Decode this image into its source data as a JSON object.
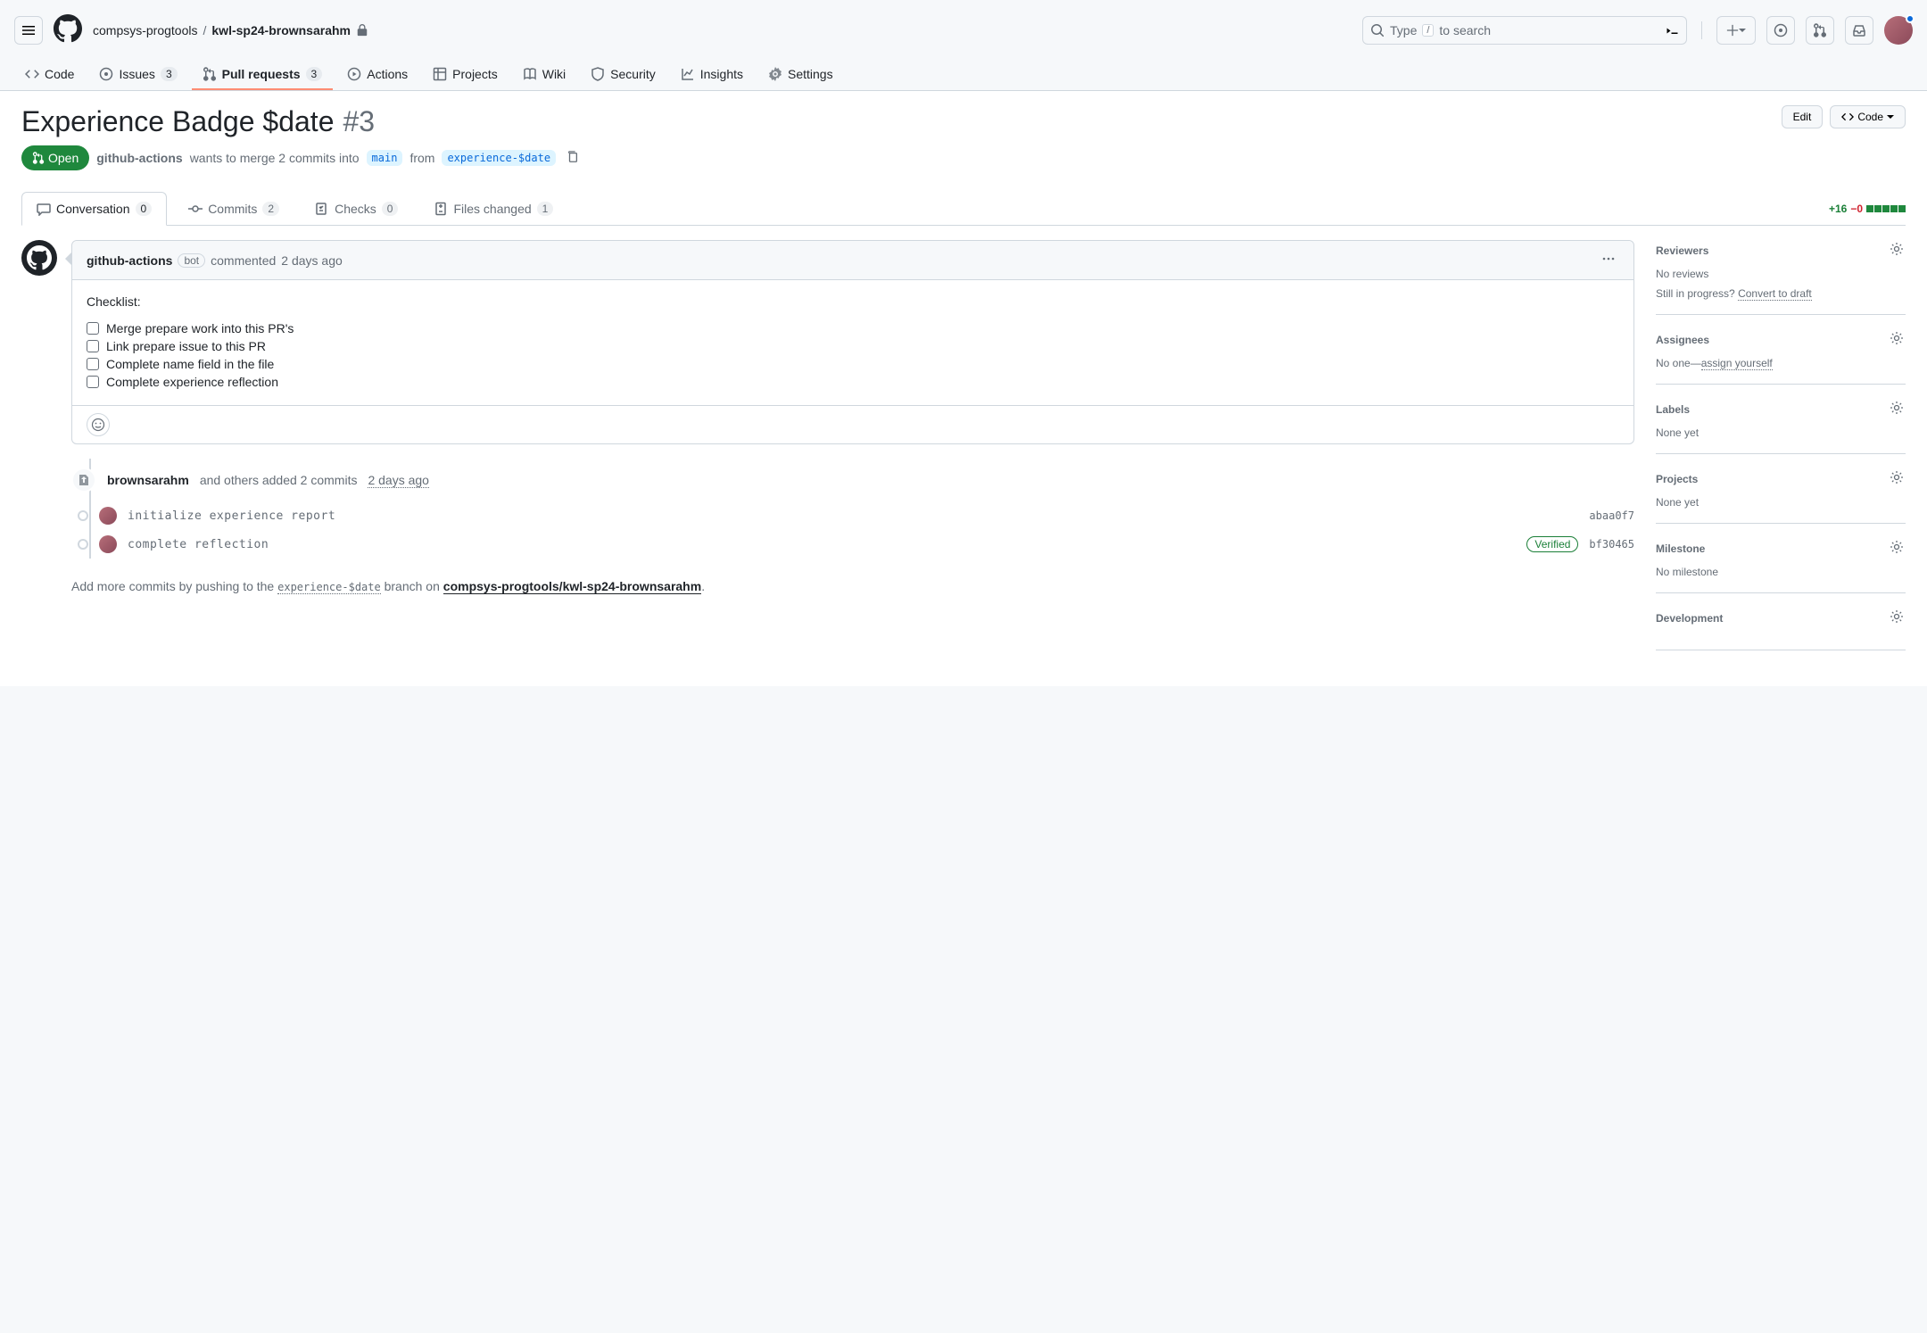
{
  "header": {
    "breadcrumb": {
      "owner": "compsys-progtools",
      "repo": "kwl-sp24-brownsarahm"
    },
    "search": {
      "placeholder_prefix": "Type",
      "placeholder_key": "/",
      "placeholder_suffix": "to search"
    }
  },
  "nav": {
    "code": "Code",
    "issues": {
      "label": "Issues",
      "count": "3"
    },
    "pull_requests": {
      "label": "Pull requests",
      "count": "3"
    },
    "actions": "Actions",
    "projects": "Projects",
    "wiki": "Wiki",
    "security": "Security",
    "insights": "Insights",
    "settings": "Settings"
  },
  "pr": {
    "title": "Experience Badge $date",
    "number": "#3",
    "edit": "Edit",
    "code_btn": "Code",
    "state": "Open",
    "author": "github-actions",
    "merge_text_1": "wants to merge 2 commits into",
    "base": "main",
    "merge_text_2": "from",
    "head": "experience-$date"
  },
  "tabs": {
    "conversation": {
      "label": "Conversation",
      "count": "0"
    },
    "commits": {
      "label": "Commits",
      "count": "2"
    },
    "checks": {
      "label": "Checks",
      "count": "0"
    },
    "files": {
      "label": "Files changed",
      "count": "1"
    },
    "additions": "+16",
    "deletions": "−0"
  },
  "comment": {
    "author": "github-actions",
    "bot": "bot",
    "commented": "commented",
    "time": "2 days ago",
    "body_intro": "Checklist:",
    "tasks": [
      "Merge prepare work into this PR's",
      "Link prepare issue to this PR",
      "Complete name field in the file",
      "Complete experience reflection"
    ]
  },
  "events": {
    "push": {
      "author": "brownsarahm",
      "text": "and others added 2 commits",
      "time": "2 days ago"
    },
    "commits": [
      {
        "msg": "initialize experience report",
        "sha": "abaa0f7",
        "verified": false
      },
      {
        "msg": "complete reflection",
        "sha": "bf30465",
        "verified": true
      }
    ],
    "verified_label": "Verified"
  },
  "hint": {
    "prefix": "Add more commits by pushing to the",
    "branch": "experience-$date",
    "mid": "branch on",
    "repo": "compsys-progtools/kwl-sp24-brownsarahm"
  },
  "sidebar": {
    "reviewers": {
      "title": "Reviewers",
      "text": "No reviews",
      "progress": "Still in progress?",
      "convert": "Convert to draft"
    },
    "assignees": {
      "title": "Assignees",
      "prefix": "No one—",
      "link": "assign yourself"
    },
    "labels": {
      "title": "Labels",
      "text": "None yet"
    },
    "projects": {
      "title": "Projects",
      "text": "None yet"
    },
    "milestone": {
      "title": "Milestone",
      "text": "No milestone"
    },
    "development": {
      "title": "Development"
    }
  }
}
